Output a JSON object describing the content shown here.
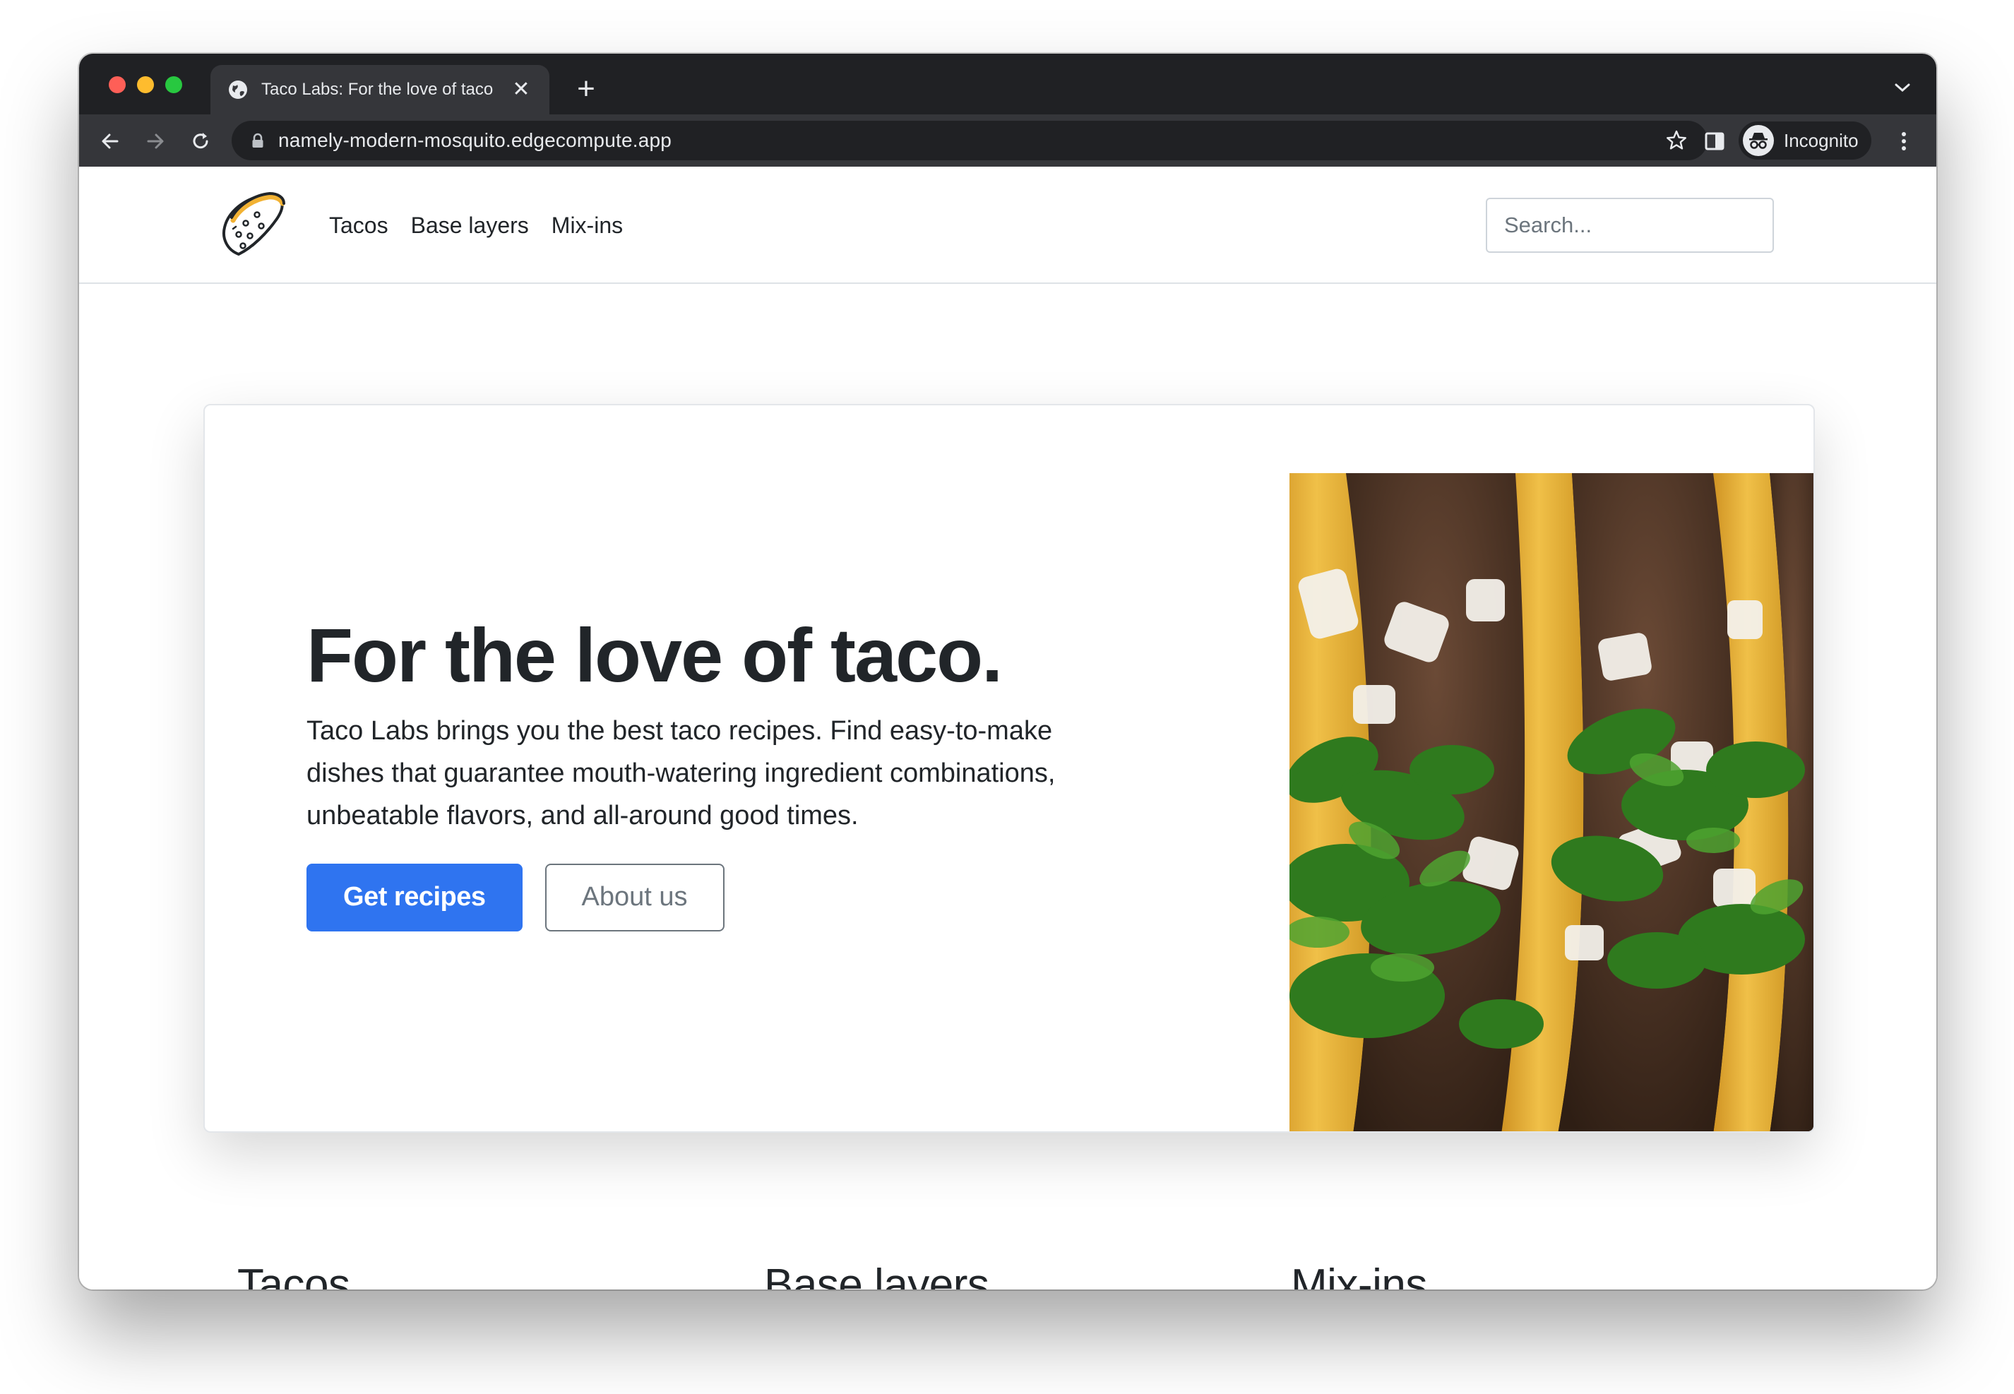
{
  "browser": {
    "tab_title": "Taco Labs: For the love of taco",
    "tab_close": "✕",
    "new_tab": "+",
    "url": "namely-modern-mosquito.edgecompute.app",
    "profile_label": "Incognito"
  },
  "site": {
    "nav_links": [
      "Tacos",
      "Base layers",
      "Mix-ins"
    ],
    "search_placeholder": "Search..."
  },
  "hero": {
    "title": "For the love of taco.",
    "lead": "Taco Labs brings you the best taco recipes. Find easy-to-make dishes that guarantee mouth-watering ingredient combinations, unbeatable flavors, and all-around good times.",
    "primary_button": "Get recipes",
    "secondary_button": "About us"
  },
  "sections": [
    "Tacos",
    "Base layers",
    "Mix-ins"
  ],
  "colors": {
    "primary": "#2f74f0",
    "text": "#212529",
    "chrome_dark": "#202124",
    "chrome_toolbar": "#35363a"
  }
}
